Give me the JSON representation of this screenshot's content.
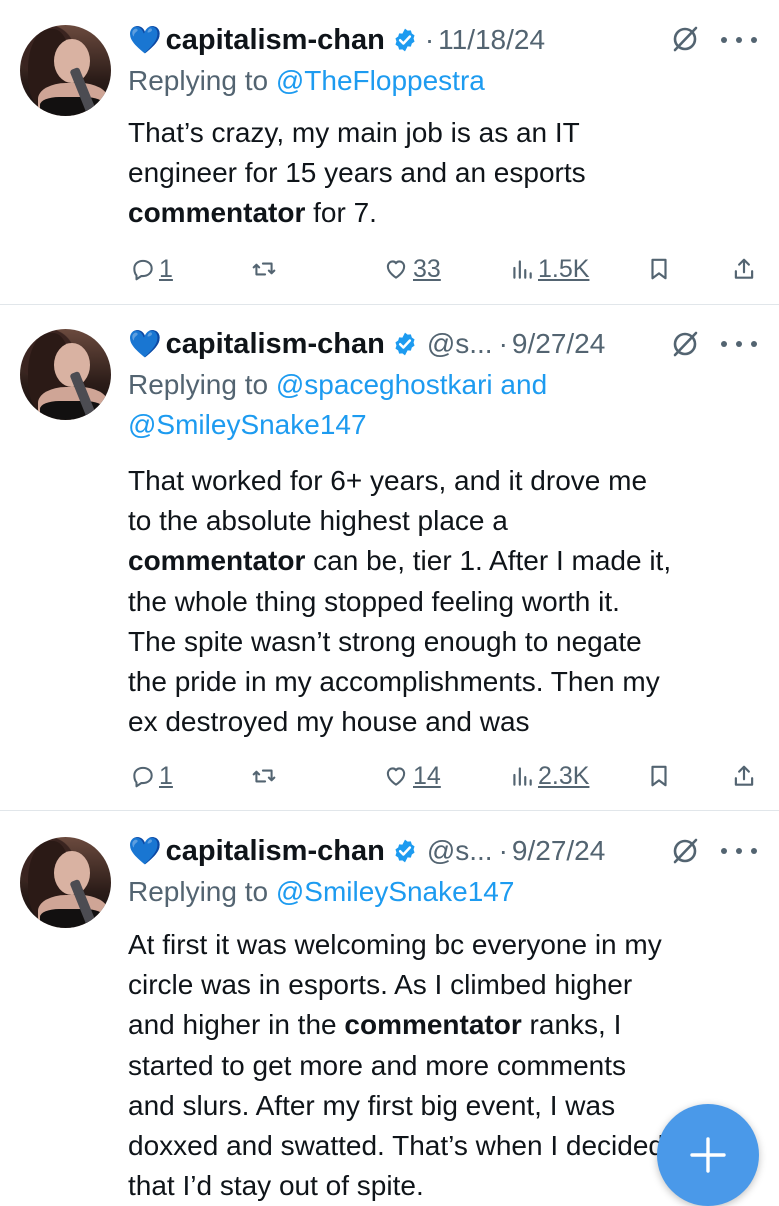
{
  "tweets": [
    {
      "author": "capitalism-chan",
      "handle": "",
      "date": "11/18/24",
      "reply_prefix": "Replying to ",
      "mentions_line1": "@TheFloppestra",
      "mentions_and": "",
      "mentions_line2": "",
      "body": {
        "line1": "That’s crazy, my main job is as an IT",
        "line2": "engineer for 15 years and an esports",
        "line3_bold": "commentator",
        "line3_rest": " for 7."
      },
      "stats": {
        "replies": "1",
        "reposts": "",
        "likes": "33",
        "views": "1.5K"
      }
    },
    {
      "author": "capitalism-chan",
      "handle": "@s...",
      "date": "9/27/24",
      "reply_prefix": "Replying to ",
      "mentions_line1": "@spaceghostkari",
      "mentions_and": " and",
      "mentions_line2": "@SmileySnake147",
      "body": {
        "line1": "That worked for 6+ years, and it drove me",
        "line2": "to the absolute highest place a",
        "line3_bold": "commentator",
        "line3_rest": " can be, tier 1. After I made it,",
        "line4": "the whole thing stopped feeling worth it.",
        "line5": "The spite wasn’t strong enough to negate",
        "line6": "the pride in my accomplishments. Then my",
        "line7": "ex destroyed my house and was"
      },
      "stats": {
        "replies": "1",
        "reposts": "",
        "likes": "14",
        "views": "2.3K"
      }
    },
    {
      "author": "capitalism-chan",
      "handle": "@s...",
      "date": "9/27/24",
      "reply_prefix": "Replying to ",
      "mentions_line1": "@SmileySnake147",
      "body": {
        "line1": "At first it was welcoming bc everyone in my",
        "line2": "circle was in esports. As I climbed higher",
        "line3_pre": "and higher in the ",
        "line3_bold": "commentator",
        "line3_rest": " ranks, I",
        "line4": "started to get more and more comments",
        "line5": "and slurs. After my first big event, I was",
        "line6": "doxxed and swatted. That’s when I decided",
        "line7": "that I’d stay out of spite."
      }
    }
  ],
  "icons": {
    "heart_emoji": "💙",
    "verified": "verified-badge-icon",
    "grok": "grok-icon",
    "more": "more-icon",
    "reply": "reply-icon",
    "repost": "repost-icon",
    "like": "like-icon",
    "views": "views-icon",
    "bookmark": "bookmark-icon",
    "share": "share-icon",
    "compose": "compose-plus-icon"
  },
  "colors": {
    "accent": "#1d9bf0",
    "muted": "#536471",
    "fab": "#4a99e9",
    "heart": "#1d6ff2"
  }
}
